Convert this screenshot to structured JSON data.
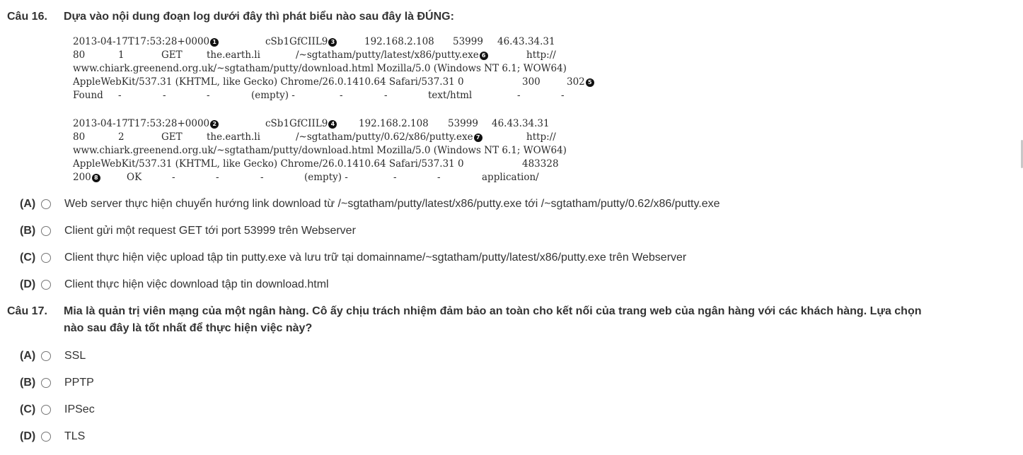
{
  "q16": {
    "num": "Câu 16.",
    "text": "Dựa vào nội dung đoạn log dưới đây thì phát biểu nào sau đây là ĐÚNG:",
    "log": {
      "r1": {
        "ts": "2013-04-17T17:53:28+0000",
        "m1": "1",
        "uid": "cSb1GfCIIL9",
        "m3": "3",
        "orig_ip": "192.168.2.108",
        "orig_port": "53999",
        "resp_ip": "46.43.34.31"
      },
      "r2": {
        "port": "80",
        "depth": "1",
        "method": "GET",
        "host": "the.earth.li",
        "uri": "/~sgtatham/putty/latest/x86/putty.exe",
        "m6": "6",
        "ref": "http://"
      },
      "r3": "www.chiark.greenend.org.uk/~sgtatham/putty/download.html Mozilla/5.0 (Windows NT 6.1; WOW64)",
      "r4": {
        "text": "AppleWebKit/537.31 (KHTML, like Gecko) Chrome/26.0.1410.64 Safari/537.31 0",
        "len": "300",
        "status": "302",
        "m5": "5"
      },
      "r5": {
        "found": "Found",
        "d1": "-",
        "d2": "-",
        "d3": "-",
        "empty": "(empty) -",
        "d4": "-",
        "d5": "-",
        "mime": "text/html",
        "d6": "-",
        "d7": "-"
      },
      "r6": {
        "ts": "2013-04-17T17:53:28+0000",
        "m2": "2",
        "uid": "cSb1GfCIIL9",
        "m4": "4",
        "orig_ip": "192.168.2.108",
        "orig_port": "53999",
        "resp_ip": "46.43.34.31"
      },
      "r7": {
        "port": "80",
        "depth": "2",
        "method": "GET",
        "host": "the.earth.li",
        "uri": "/~sgtatham/putty/0.62/x86/putty.exe",
        "m7": "7",
        "ref": "http://"
      },
      "r8": "www.chiark.greenend.org.uk/~sgtatham/putty/download.html Mozilla/5.0 (Windows NT 6.1; WOW64)",
      "r9": {
        "text": "AppleWebKit/537.31 (KHTML, like Gecko) Chrome/26.0.1410.64 Safari/537.31 0",
        "len": "483328"
      },
      "r10": {
        "status": "200",
        "m8": "8",
        "ok": "OK",
        "d1": "-",
        "d2": "-",
        "d3": "-",
        "empty": "(empty) -",
        "d4": "-",
        "d5": "-",
        "mime": "application/"
      }
    },
    "options": [
      {
        "letter": "(A)",
        "text": "Web server thực hiện chuyển hướng link download từ /~sgtatham/putty/latest/x86/putty.exe tới /~sgtatham/putty/0.62/x86/putty.exe"
      },
      {
        "letter": "(B)",
        "text": "Client gửi một request GET tới port 53999 trên Webserver"
      },
      {
        "letter": "(C)",
        "text": "Client thực hiện việc upload tập tin putty.exe và lưu trữ tại domainname/~sgtatham/putty/latest/x86/putty.exe trên Webserver"
      },
      {
        "letter": "(D)",
        "text": "Client thực hiện việc download tập tin download.html"
      }
    ]
  },
  "q17": {
    "num": "Câu 17.",
    "text_line1": "Mia là quản trị viên mạng của một ngân hàng. Cô ấy chịu trách nhiệm đảm bảo an toàn cho kết nối của trang web của ngân hàng với các khách hàng. Lựa chọn",
    "text_line2": "nào sau đây là tốt nhất để thực hiện việc này?",
    "options": [
      {
        "letter": "(A)",
        "text": "SSL"
      },
      {
        "letter": "(B)",
        "text": "PPTP"
      },
      {
        "letter": "(C)",
        "text": "IPSec"
      },
      {
        "letter": "(D)",
        "text": "TLS"
      }
    ]
  }
}
